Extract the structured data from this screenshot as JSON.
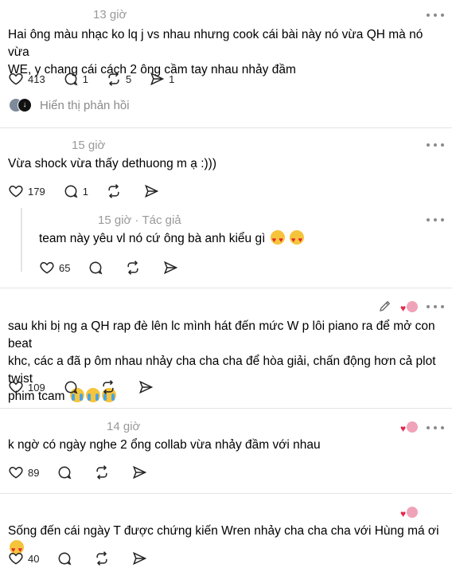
{
  "posts": [
    {
      "time": "13 giờ",
      "text_lines": [
        "Hai ông màu nhạc ko lq j vs nhau nhưng cook cái bài này nó vừa QH mà nó vừa",
        "WE, y chang cái cách 2 ông cầm tay nhau nhảy đầm"
      ],
      "likes": "413",
      "comments": "1",
      "reposts": "5",
      "shares": "1",
      "show_replies": "Hiển thị phản hồi"
    },
    {
      "time": "15 giờ",
      "text": "Vừa shock vừa thấy dethuong m ạ :)))",
      "likes": "179",
      "comments": "1"
    },
    {
      "time": "15 giờ",
      "author_tag": "Tác giả",
      "text": "team này yêu vl nó cứ ông bà anh kiểu gì",
      "likes": "65"
    },
    {
      "text_lines": [
        "sau khi bị ng a QH rap đè lên lc mình hát đến mức W p lôi piano ra để mở con beat",
        "khc, các a đã p ôm nhau nhảy cha cha cha để hòa giải, chấn động hơn cả plot twist",
        "phim tcam"
      ],
      "likes": "109"
    },
    {
      "time": "14 giờ",
      "text": "k ngờ có ngày nghe 2 ổng collab vừa nhảy đầm với nhau",
      "likes": "89"
    },
    {
      "text": "Sống đến cái ngày T được chứng kiến Wren nhảy cha cha cha với Hùng má ơi",
      "likes": "40"
    }
  ],
  "colors": {
    "divider": "#e4e4e4",
    "meta": "#999999",
    "like_heart": "#e3264a"
  },
  "icons": [
    "heart-icon",
    "comment-icon",
    "repost-icon",
    "share-icon",
    "more-icon",
    "edit-icon"
  ]
}
